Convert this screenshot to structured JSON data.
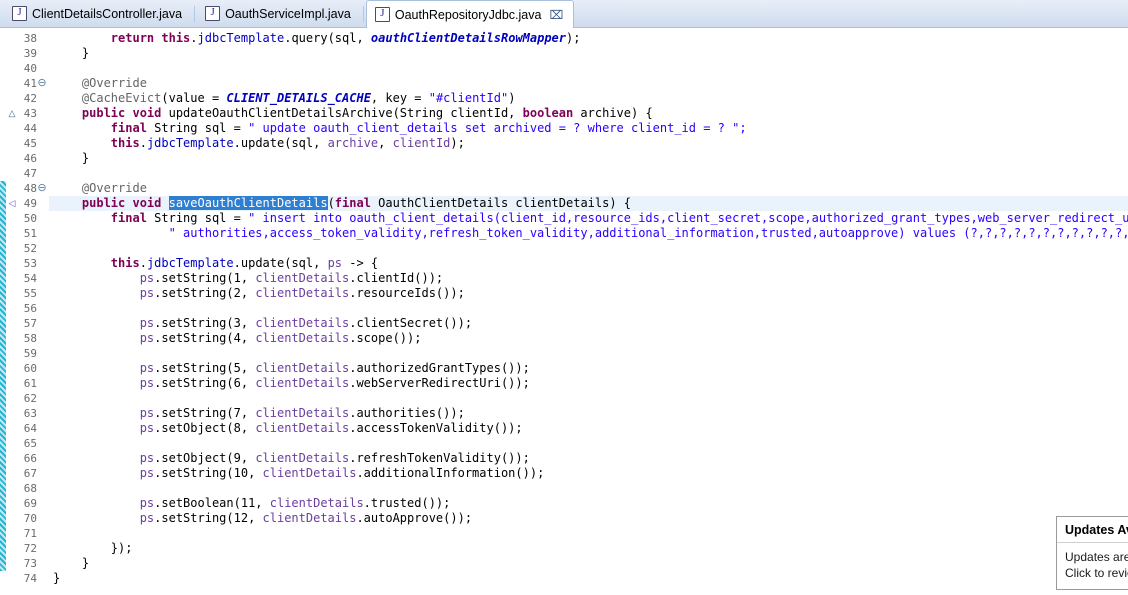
{
  "window": {
    "app": "Eclipse IDE",
    "view": "java-editor"
  },
  "tabs": [
    {
      "label": "ClientDetailsController.java",
      "icon": "java-file-icon",
      "active": false,
      "closable": false
    },
    {
      "label": "OauthServiceImpl.java",
      "icon": "java-file-icon",
      "active": false,
      "closable": false
    },
    {
      "label": "OauthRepositoryJdbc.java",
      "icon": "java-file-icon",
      "active": true,
      "closable": true,
      "close_glyph": "⌧"
    }
  ],
  "editor": {
    "first_line_number": 38,
    "last_line_number": 74,
    "current_line": 49,
    "selection_text": "saveOauthClientDetails",
    "fold_marker_glyph": "⊖",
    "override_marker_glyph": "△",
    "change_marker_glyph": "◁",
    "colors": {
      "keyword": "#7f0055",
      "string": "#2a00ff",
      "annotation": "#646464",
      "static_field": "#0000c0",
      "field": "#0000c0",
      "local_var": "#6a3e9e",
      "selection_bg": "#2f7fd0",
      "current_line_bg": "#eaf2fb",
      "change_bar": "#27b4d4",
      "tab_active_bg": "#ffffff",
      "tab_bar_bg": "#dae4f2"
    },
    "lines": [
      {
        "n": 38,
        "indent": 2,
        "fold": false,
        "override": false,
        "changed": false,
        "tokens": [
          {
            "t": "return ",
            "c": "kw"
          },
          {
            "t": "this",
            "c": "kw"
          },
          {
            "t": ".",
            "c": "plain"
          },
          {
            "t": "jdbcTemplate",
            "c": "fld"
          },
          {
            "t": ".query(sql, ",
            "c": "plain"
          },
          {
            "t": "oauthClientDetailsRowMapper",
            "c": "sfld ital"
          },
          {
            "t": ");",
            "c": "plain"
          }
        ]
      },
      {
        "n": 39,
        "indent": 1,
        "fold": false,
        "override": false,
        "changed": false,
        "tokens": [
          {
            "t": "}",
            "c": "plain"
          }
        ]
      },
      {
        "n": 40,
        "indent": 0,
        "fold": false,
        "override": false,
        "changed": false,
        "tokens": []
      },
      {
        "n": 41,
        "indent": 1,
        "fold": true,
        "override": false,
        "changed": false,
        "tokens": [
          {
            "t": "@Override",
            "c": "ann"
          }
        ]
      },
      {
        "n": 42,
        "indent": 1,
        "fold": false,
        "override": false,
        "changed": false,
        "tokens": [
          {
            "t": "@CacheEvict",
            "c": "ann"
          },
          {
            "t": "(value = ",
            "c": "plain"
          },
          {
            "t": "CLIENT_DETAILS_CACHE",
            "c": "sfld"
          },
          {
            "t": ", key = ",
            "c": "plain"
          },
          {
            "t": "\"#clientId\"",
            "c": "str"
          },
          {
            "t": ")",
            "c": "plain"
          }
        ]
      },
      {
        "n": 43,
        "indent": 1,
        "fold": false,
        "override": true,
        "changed": false,
        "tokens": [
          {
            "t": "public void ",
            "c": "kw"
          },
          {
            "t": "updateOauthClientDetailsArchive(String clientId, ",
            "c": "plain"
          },
          {
            "t": "boolean ",
            "c": "kw"
          },
          {
            "t": "archive) {",
            "c": "plain"
          }
        ]
      },
      {
        "n": 44,
        "indent": 2,
        "fold": false,
        "override": false,
        "changed": false,
        "tokens": [
          {
            "t": "final ",
            "c": "kw"
          },
          {
            "t": "String sql = ",
            "c": "plain"
          },
          {
            "t": "\" update oauth_client_details set archived = ? where client_id = ? \";",
            "c": "str"
          }
        ]
      },
      {
        "n": 45,
        "indent": 2,
        "fold": false,
        "override": false,
        "changed": false,
        "tokens": [
          {
            "t": "this",
            "c": "kw"
          },
          {
            "t": ".",
            "c": "plain"
          },
          {
            "t": "jdbcTemplate",
            "c": "fld"
          },
          {
            "t": ".update(sql, ",
            "c": "plain"
          },
          {
            "t": "archive",
            "c": "loc"
          },
          {
            "t": ", ",
            "c": "plain"
          },
          {
            "t": "clientId",
            "c": "loc"
          },
          {
            "t": ");",
            "c": "plain"
          }
        ]
      },
      {
        "n": 46,
        "indent": 1,
        "fold": false,
        "override": false,
        "changed": false,
        "tokens": [
          {
            "t": "}",
            "c": "plain"
          }
        ]
      },
      {
        "n": 47,
        "indent": 0,
        "fold": false,
        "override": false,
        "changed": false,
        "tokens": []
      },
      {
        "n": 48,
        "indent": 1,
        "fold": true,
        "override": false,
        "changed": true,
        "tokens": [
          {
            "t": "@Override",
            "c": "ann"
          }
        ]
      },
      {
        "n": 49,
        "indent": 1,
        "fold": false,
        "override": false,
        "changed": true,
        "change_arrow": true,
        "tokens": [
          {
            "t": "public void ",
            "c": "kw"
          },
          {
            "t": "saveOauthClientDetails",
            "c": "sel"
          },
          {
            "t": "(",
            "c": "plain"
          },
          {
            "t": "final ",
            "c": "kw"
          },
          {
            "t": "OauthClientDetails clientDetails) {",
            "c": "plain"
          }
        ]
      },
      {
        "n": 50,
        "indent": 2,
        "fold": false,
        "override": false,
        "changed": true,
        "tokens": [
          {
            "t": "final ",
            "c": "kw"
          },
          {
            "t": "String sql = ",
            "c": "plain"
          },
          {
            "t": "\" insert into oauth_client_details(client_id,resource_ids,client_secret,scope,authorized_grant_types,web_server_redirect_uri,\"",
            "c": "str"
          },
          {
            "t": " +",
            "c": "plain"
          }
        ]
      },
      {
        "n": 51,
        "indent": 4,
        "fold": false,
        "override": false,
        "changed": true,
        "tokens": [
          {
            "t": "\" authorities,access_token_validity,refresh_token_validity,additional_information,trusted,autoapprove) values (?,?,?,?,?,?,?,?,?,?,?,?)\";",
            "c": "str"
          }
        ]
      },
      {
        "n": 52,
        "indent": 0,
        "fold": false,
        "override": false,
        "changed": true,
        "tokens": []
      },
      {
        "n": 53,
        "indent": 2,
        "fold": false,
        "override": false,
        "changed": true,
        "tokens": [
          {
            "t": "this",
            "c": "kw"
          },
          {
            "t": ".",
            "c": "plain"
          },
          {
            "t": "jdbcTemplate",
            "c": "fld"
          },
          {
            "t": ".update(sql, ",
            "c": "plain"
          },
          {
            "t": "ps",
            "c": "loc"
          },
          {
            "t": " -> {",
            "c": "plain"
          }
        ]
      },
      {
        "n": 54,
        "indent": 3,
        "fold": false,
        "override": false,
        "changed": true,
        "tokens": [
          {
            "t": "ps",
            "c": "loc"
          },
          {
            "t": ".setString(1, ",
            "c": "plain"
          },
          {
            "t": "clientDetails",
            "c": "loc"
          },
          {
            "t": ".clientId());",
            "c": "plain"
          }
        ]
      },
      {
        "n": 55,
        "indent": 3,
        "fold": false,
        "override": false,
        "changed": true,
        "tokens": [
          {
            "t": "ps",
            "c": "loc"
          },
          {
            "t": ".setString(2, ",
            "c": "plain"
          },
          {
            "t": "clientDetails",
            "c": "loc"
          },
          {
            "t": ".resourceIds());",
            "c": "plain"
          }
        ]
      },
      {
        "n": 56,
        "indent": 0,
        "fold": false,
        "override": false,
        "changed": true,
        "tokens": []
      },
      {
        "n": 57,
        "indent": 3,
        "fold": false,
        "override": false,
        "changed": true,
        "tokens": [
          {
            "t": "ps",
            "c": "loc"
          },
          {
            "t": ".setString(3, ",
            "c": "plain"
          },
          {
            "t": "clientDetails",
            "c": "loc"
          },
          {
            "t": ".clientSecret());",
            "c": "plain"
          }
        ]
      },
      {
        "n": 58,
        "indent": 3,
        "fold": false,
        "override": false,
        "changed": true,
        "tokens": [
          {
            "t": "ps",
            "c": "loc"
          },
          {
            "t": ".setString(4, ",
            "c": "plain"
          },
          {
            "t": "clientDetails",
            "c": "loc"
          },
          {
            "t": ".scope());",
            "c": "plain"
          }
        ]
      },
      {
        "n": 59,
        "indent": 0,
        "fold": false,
        "override": false,
        "changed": true,
        "tokens": []
      },
      {
        "n": 60,
        "indent": 3,
        "fold": false,
        "override": false,
        "changed": true,
        "tokens": [
          {
            "t": "ps",
            "c": "loc"
          },
          {
            "t": ".setString(5, ",
            "c": "plain"
          },
          {
            "t": "clientDetails",
            "c": "loc"
          },
          {
            "t": ".authorizedGrantTypes());",
            "c": "plain"
          }
        ]
      },
      {
        "n": 61,
        "indent": 3,
        "fold": false,
        "override": false,
        "changed": true,
        "tokens": [
          {
            "t": "ps",
            "c": "loc"
          },
          {
            "t": ".setString(6, ",
            "c": "plain"
          },
          {
            "t": "clientDetails",
            "c": "loc"
          },
          {
            "t": ".webServerRedirectUri());",
            "c": "plain"
          }
        ]
      },
      {
        "n": 62,
        "indent": 0,
        "fold": false,
        "override": false,
        "changed": true,
        "tokens": []
      },
      {
        "n": 63,
        "indent": 3,
        "fold": false,
        "override": false,
        "changed": true,
        "tokens": [
          {
            "t": "ps",
            "c": "loc"
          },
          {
            "t": ".setString(7, ",
            "c": "plain"
          },
          {
            "t": "clientDetails",
            "c": "loc"
          },
          {
            "t": ".authorities());",
            "c": "plain"
          }
        ]
      },
      {
        "n": 64,
        "indent": 3,
        "fold": false,
        "override": false,
        "changed": true,
        "tokens": [
          {
            "t": "ps",
            "c": "loc"
          },
          {
            "t": ".setObject(8, ",
            "c": "plain"
          },
          {
            "t": "clientDetails",
            "c": "loc"
          },
          {
            "t": ".accessTokenValidity());",
            "c": "plain"
          }
        ]
      },
      {
        "n": 65,
        "indent": 0,
        "fold": false,
        "override": false,
        "changed": true,
        "tokens": []
      },
      {
        "n": 66,
        "indent": 3,
        "fold": false,
        "override": false,
        "changed": true,
        "tokens": [
          {
            "t": "ps",
            "c": "loc"
          },
          {
            "t": ".setObject(9, ",
            "c": "plain"
          },
          {
            "t": "clientDetails",
            "c": "loc"
          },
          {
            "t": ".refreshTokenValidity());",
            "c": "plain"
          }
        ]
      },
      {
        "n": 67,
        "indent": 3,
        "fold": false,
        "override": false,
        "changed": true,
        "tokens": [
          {
            "t": "ps",
            "c": "loc"
          },
          {
            "t": ".setString(10, ",
            "c": "plain"
          },
          {
            "t": "clientDetails",
            "c": "loc"
          },
          {
            "t": ".additionalInformation());",
            "c": "plain"
          }
        ]
      },
      {
        "n": 68,
        "indent": 0,
        "fold": false,
        "override": false,
        "changed": true,
        "tokens": []
      },
      {
        "n": 69,
        "indent": 3,
        "fold": false,
        "override": false,
        "changed": true,
        "tokens": [
          {
            "t": "ps",
            "c": "loc"
          },
          {
            "t": ".setBoolean(11, ",
            "c": "plain"
          },
          {
            "t": "clientDetails",
            "c": "loc"
          },
          {
            "t": ".trusted());",
            "c": "plain"
          }
        ]
      },
      {
        "n": 70,
        "indent": 3,
        "fold": false,
        "override": false,
        "changed": true,
        "tokens": [
          {
            "t": "ps",
            "c": "loc"
          },
          {
            "t": ".setString(12, ",
            "c": "plain"
          },
          {
            "t": "clientDetails",
            "c": "loc"
          },
          {
            "t": ".autoApprove());",
            "c": "plain"
          }
        ]
      },
      {
        "n": 71,
        "indent": 0,
        "fold": false,
        "override": false,
        "changed": true,
        "tokens": []
      },
      {
        "n": 72,
        "indent": 2,
        "fold": false,
        "override": false,
        "changed": true,
        "tokens": [
          {
            "t": "});",
            "c": "plain"
          }
        ]
      },
      {
        "n": 73,
        "indent": 1,
        "fold": false,
        "override": false,
        "changed": true,
        "tokens": [
          {
            "t": "}",
            "c": "plain"
          }
        ]
      },
      {
        "n": 74,
        "indent": 0,
        "fold": false,
        "override": false,
        "changed": false,
        "tokens": [
          {
            "t": "}",
            "c": "plain"
          }
        ]
      }
    ]
  },
  "notification": {
    "title": "Updates Available",
    "line1": "Updates are available.",
    "line2": "Click to review."
  }
}
